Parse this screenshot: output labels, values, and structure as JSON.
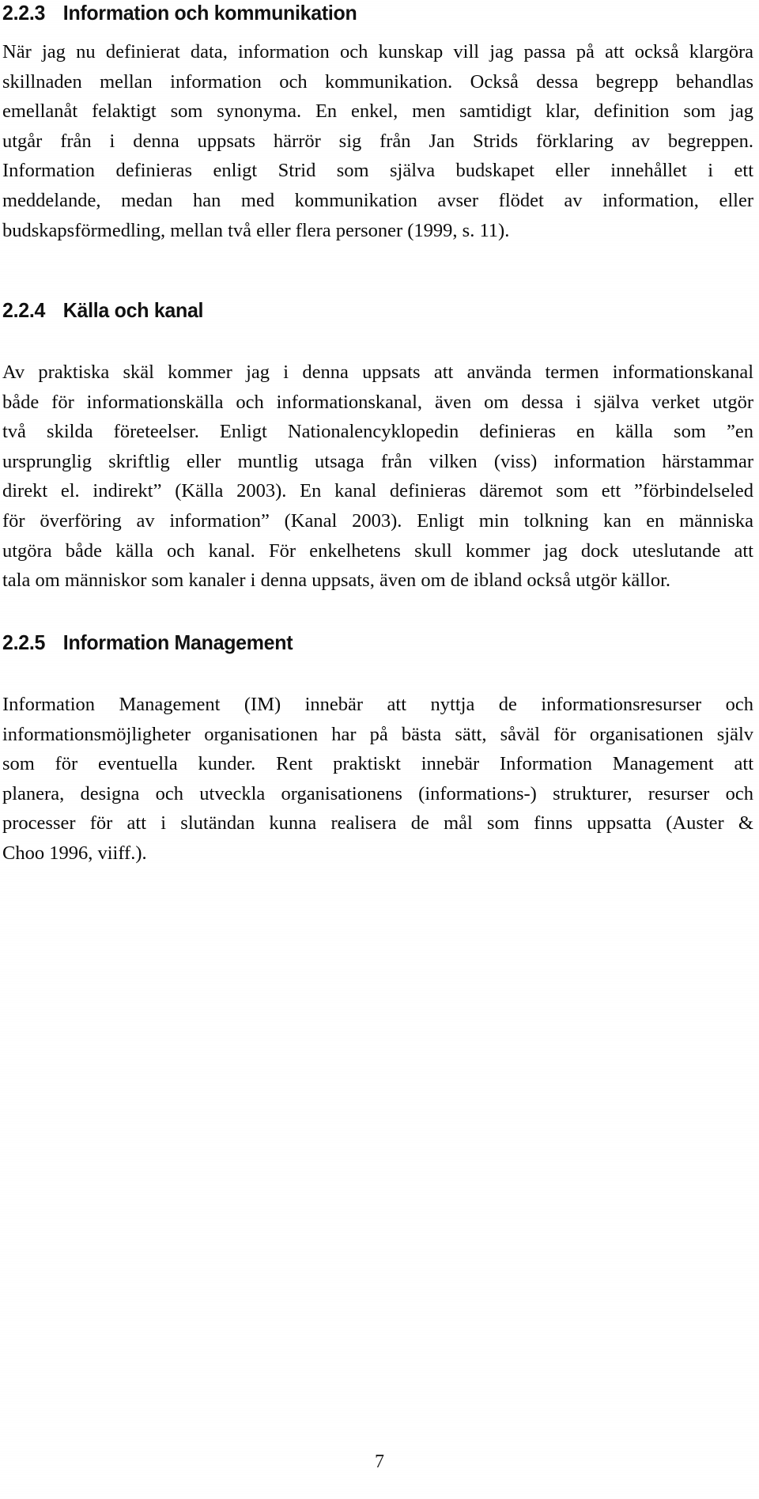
{
  "document": {
    "language": "sv",
    "page_number": "7"
  },
  "sections": [
    {
      "number": "2.2.3",
      "title": "Information och kommunikation",
      "paragraph_lines": [
        "När jag nu definierat data, information och kunskap vill jag passa på att också klargöra",
        "skillnaden mellan information och kommunikation. Också dessa begrepp behandlas",
        "emellanåt felaktigt som synonyma. En enkel, men samtidigt klar, definition som jag",
        "utgår från i denna uppsats härrör sig från Jan Strids förklaring av begreppen.",
        "Information definieras enligt Strid som själva budskapet eller innehållet i ett",
        "meddelande, medan han med kommunikation avser flödet av information, eller",
        "budskapsförmedling, mellan två eller flera personer (1999, s. 11)."
      ]
    },
    {
      "number": "2.2.4",
      "title": "Källa och kanal",
      "paragraph_lines": [
        "Av praktiska skäl kommer jag i denna uppsats att använda termen informationskanal",
        "både för informationskälla och informationskanal, även om dessa i själva verket utgör",
        "två skilda företeelser. Enligt Nationalencyklopedin definieras en källa som ”en",
        "ursprunglig skriftlig eller muntlig utsaga från vilken (viss) information härstammar",
        "direkt el. indirekt” (Källa 2003). En kanal definieras däremot som ett ”förbindelseled",
        "för överföring av information” (Kanal 2003). Enligt min tolkning kan en människa",
        "utgöra både källa och kanal. För enkelhetens skull kommer jag dock uteslutande att",
        "tala om människor som kanaler i denna uppsats, även om de ibland också utgör källor."
      ]
    },
    {
      "number": "2.2.5",
      "title": "Information Management",
      "paragraph_lines": [
        "Information Management (IM) innebär att nyttja de informationsresurser och",
        "informationsmöjligheter organisationen har på bästa sätt, såväl för organisationen själv",
        "som för eventuella kunder. Rent praktiskt innebär Information Management att",
        "planera, designa och utveckla organisationens (informations-) strukturer, resurser och",
        "processer för att i slutändan kunna realisera de mål som finns uppsatta (Auster &",
        "Choo 1996, viiff.)."
      ]
    }
  ],
  "colors": {
    "page_background": "#ffffff",
    "body_text": "#0b0b0b",
    "heading_text": "#111111"
  }
}
